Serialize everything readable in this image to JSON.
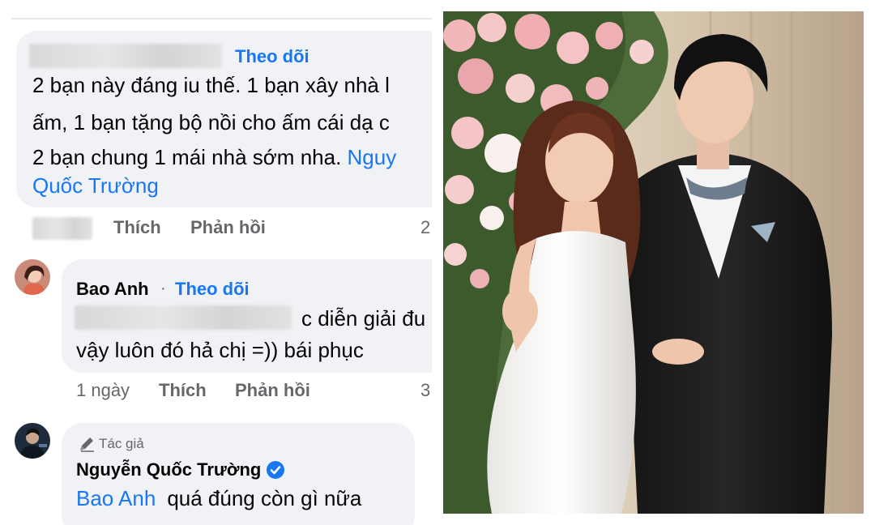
{
  "comment1": {
    "follow_label": "Theo dõi",
    "text_line1": "2 bạn này đáng iu thế. 1 bạn xây nhà l",
    "text_line2": "ấm, 1 bạn tặng bộ nồi cho ấm cái dạ c",
    "text_line3_plain": "2 bạn chung 1 mái nhà sớm nha. ",
    "text_line3_link": "Nguy",
    "text_line4_link": "Quốc Trường",
    "like_label": "Thích",
    "reply_label": "Phản hồi",
    "count": "2"
  },
  "comment2": {
    "author": "Bao Anh",
    "separator": "·",
    "follow_label": "Theo dõi",
    "text_line1": "c diễn giải đu",
    "text_line2": "vậy luôn đó hả chị =)) bái phục",
    "time": "1 ngày",
    "like_label": "Thích",
    "reply_label": "Phản hồi",
    "count": "3"
  },
  "comment3": {
    "author_badge": "Tác giả",
    "author": "Nguyễn Quốc Trường",
    "mention": "Bao Anh",
    "text": "quá đúng còn gì nữa"
  },
  "colors": {
    "link": "#1877f2",
    "bubble": "#f0f2f5",
    "meta": "#65676b",
    "text": "#050505"
  },
  "icons": [
    "pencil-icon",
    "verified-check-icon"
  ]
}
